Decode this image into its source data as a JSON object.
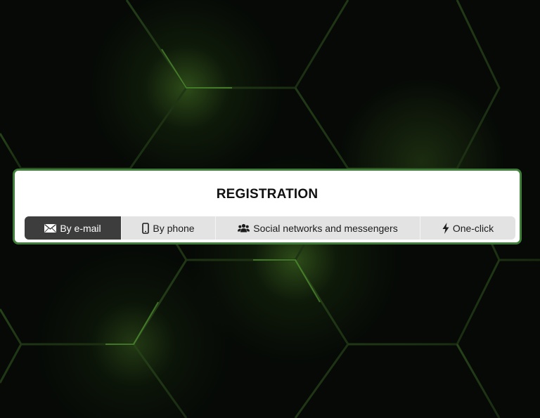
{
  "modal": {
    "title": "REGISTRATION",
    "tabs": [
      {
        "label": "By e-mail",
        "icon": "envelope-icon",
        "active": true
      },
      {
        "label": "By phone",
        "icon": "phone-icon",
        "active": false
      },
      {
        "label": "Social networks and messengers",
        "icon": "users-icon",
        "active": false
      },
      {
        "label": "One-click",
        "icon": "lightning-icon",
        "active": false
      }
    ]
  },
  "colors": {
    "modal_border": "#3f7f3a",
    "active_tab_bg": "#3d3d3d",
    "tab_bar_bg": "#e3e3e3",
    "background_glow": "#78c83c"
  }
}
